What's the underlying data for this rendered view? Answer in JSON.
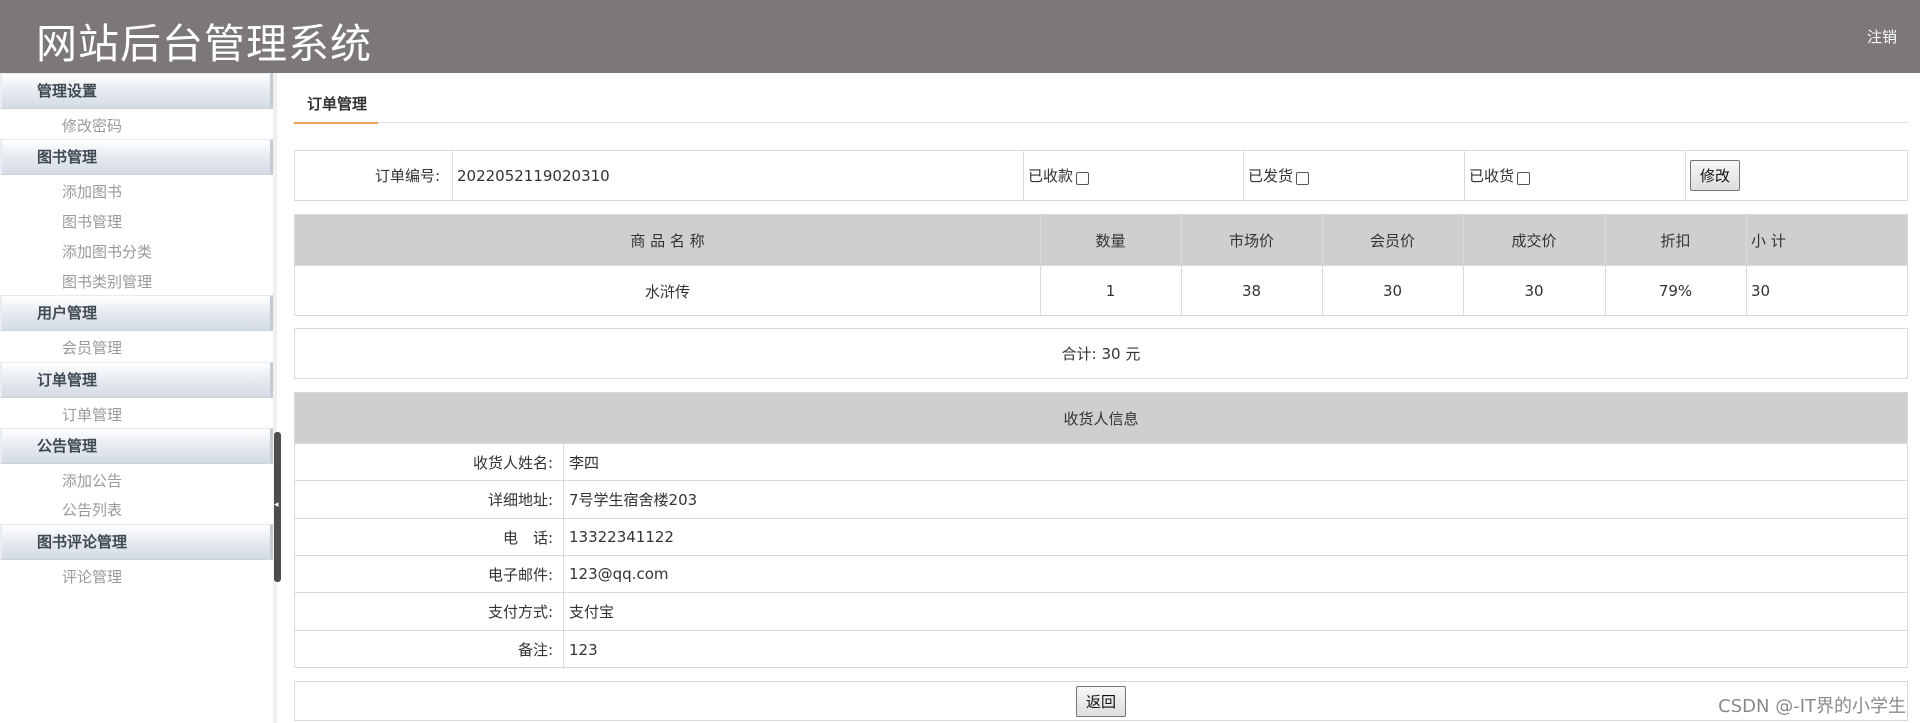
{
  "header": {
    "title": "网站后台管理系统",
    "logout_label": "注销"
  },
  "sidebar": {
    "groups": [
      {
        "label": "管理设置",
        "items": [
          "修改密码"
        ]
      },
      {
        "label": "图书管理",
        "items": [
          "添加图书",
          "图书管理",
          "添加图书分类",
          "图书类别管理"
        ]
      },
      {
        "label": "用户管理",
        "items": [
          "会员管理"
        ]
      },
      {
        "label": "订单管理",
        "items": [
          "订单管理"
        ]
      },
      {
        "label": "公告管理",
        "items": [
          "添加公告",
          "公告列表"
        ]
      },
      {
        "label": "图书评论管理",
        "items": [
          "评论管理"
        ]
      }
    ]
  },
  "main": {
    "tab_label": "订单管理",
    "order": {
      "number_label": "订单编号:",
      "number_value": "2022052119020310",
      "paid_label": "已收款",
      "shipped_label": "已发货",
      "received_label": "已收货",
      "modify_label": "修改"
    },
    "items_table": {
      "headers": [
        "商 品 名 称",
        "数量",
        "市场价",
        "会员价",
        "成交价",
        "折扣",
        "小 计"
      ],
      "rows": [
        [
          "水浒传",
          "1",
          "38",
          "30",
          "30",
          "79%",
          "30"
        ]
      ]
    },
    "total_text": "合计: 30 元",
    "receiver": {
      "header": "收货人信息",
      "rows": [
        {
          "label": "收货人姓名:",
          "value": "李四"
        },
        {
          "label": "详细地址:",
          "value": "7号学生宿舍楼203"
        },
        {
          "label": "电　话:",
          "value": "13322341122"
        },
        {
          "label": "电子邮件:",
          "value": "123@qq.com"
        },
        {
          "label": "支付方式:",
          "value": "支付宝"
        },
        {
          "label": "备注:",
          "value": "123"
        }
      ]
    },
    "back_label": "返回"
  },
  "watermark": "CSDN @-IT界的小学生"
}
